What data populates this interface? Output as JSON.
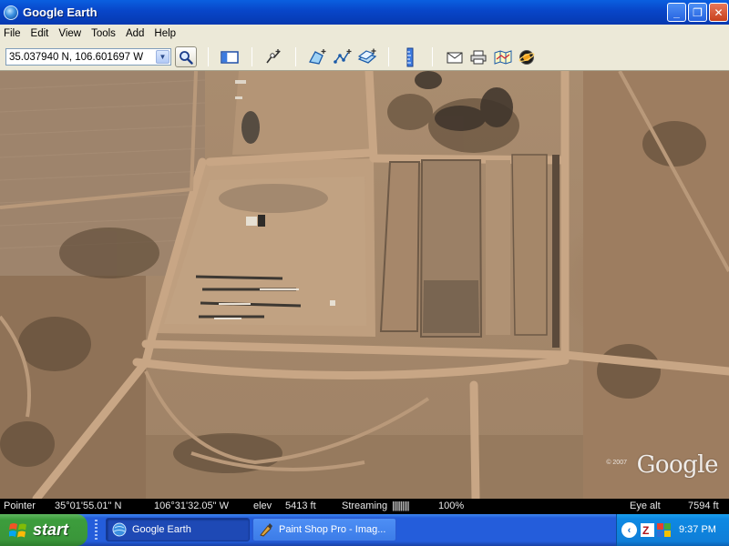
{
  "window": {
    "title": "Google Earth",
    "buttons": {
      "minimize": "_",
      "maximize": "❐",
      "close": "✕"
    }
  },
  "menu": {
    "items": [
      "File",
      "Edit",
      "View",
      "Tools",
      "Add",
      "Help"
    ]
  },
  "toolbar": {
    "coordinate_input_value": "35.037940 N, 106.601697 W",
    "icons": [
      "search-icon",
      "sidebar-toggle-icon",
      "add-placemark-icon",
      "add-polygon-icon",
      "add-path-icon",
      "add-image-overlay-icon",
      "ruler-icon",
      "email-icon",
      "print-icon",
      "show-in-maps-icon",
      "sky-toggle-icon"
    ]
  },
  "map": {
    "watermark": "Google",
    "watermark_year": "© 2007"
  },
  "status": {
    "pointer_label": "Pointer",
    "latitude": "35°01'55.01\" N",
    "longitude": "106°31'32.05\" W",
    "elev_label": "elev",
    "elev_value": "5413 ft",
    "streaming_label": "Streaming",
    "streaming_bars": "||||||||||",
    "streaming_percent": "100%",
    "eye_alt_label": "Eye alt",
    "eye_alt_value": "7594 ft"
  },
  "taskbar": {
    "start_label": "start",
    "tasks": [
      {
        "label": "Google Earth",
        "active": true
      },
      {
        "label": "Paint Shop Pro - Imag...",
        "active": false
      }
    ],
    "clock": "9:37 PM"
  },
  "colors": {
    "title_bar": "#0845c8",
    "taskbar": "#245ddb",
    "start_button": "#3a963a",
    "tray": "#0f7ed8",
    "terrain": "#a98c6f"
  }
}
